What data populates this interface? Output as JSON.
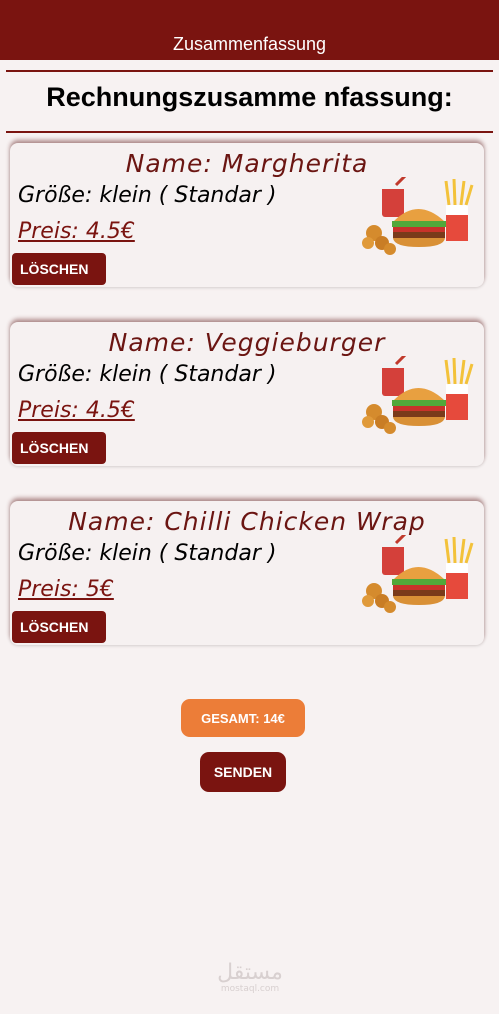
{
  "header": {
    "title": "Zusammenfassung"
  },
  "summary_heading": "Rechnungszusamme nfassung:",
  "items": [
    {
      "name": "Name: Margherita",
      "size": "Größe: klein ( Standar )",
      "price": "Preis: 4.5€",
      "delete_label": "LÖSCHEN",
      "image_icon": "fast-food-icon"
    },
    {
      "name": "Name: Veggieburger",
      "size": "Größe: klein ( Standar )",
      "price": "Preis: 4.5€",
      "delete_label": "LÖSCHEN",
      "image_icon": "fast-food-icon"
    },
    {
      "name": "Name: Chilli Chicken Wrap",
      "size": "Größe: klein ( Standar )",
      "price": "Preis: 5€",
      "delete_label": "LÖSCHEN",
      "image_icon": "fast-food-icon"
    }
  ],
  "total_label": "GESAMT: 14€",
  "send_label": "SENDEN",
  "watermark": {
    "main": "مستقل",
    "sub": "mostaql.com"
  },
  "colors": {
    "primary": "#7a1410",
    "accent": "#ec7d38",
    "background": "#f7f2f2"
  }
}
